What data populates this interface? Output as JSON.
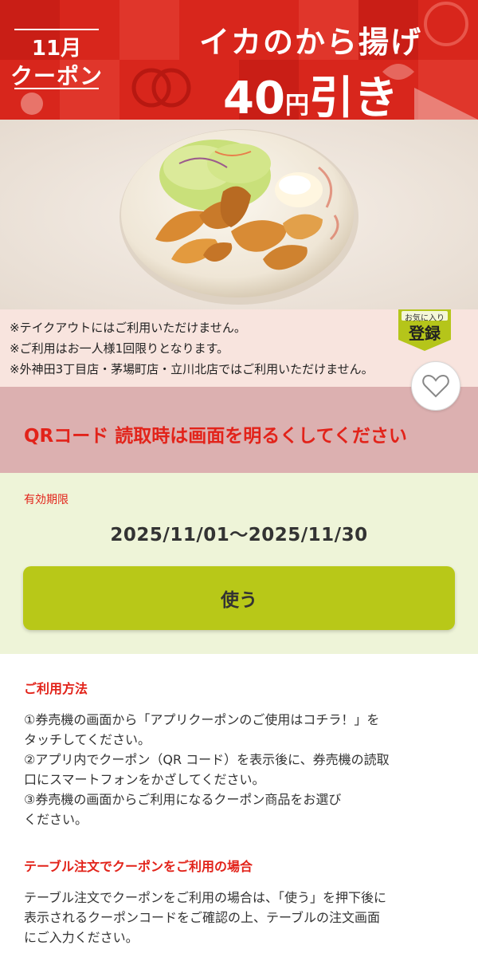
{
  "banner": {
    "month": "11月",
    "coupon": "クーポン",
    "title": "イカのから揚げ",
    "price_number": "40",
    "price_yen": "円",
    "price_off": "引き"
  },
  "notes": [
    "※テイクアウトにはご利用いただけません。",
    "※ご利用はお一人様1回限りとなります。",
    "※外神田3丁目店・茅場町店・立川北店ではご利用いただけません。"
  ],
  "favorite_tag": {
    "small": "お気に入り",
    "big": "登録"
  },
  "qr_notice": "QRコード 読取時は画面を明るくしてください",
  "validity": {
    "label": "有効期限",
    "dates": "2025/11/01～2025/11/30"
  },
  "use_button": "使う",
  "howto": {
    "heading": "ご利用方法",
    "steps": [
      "①券売機の画面から「アプリクーポンのご使用はコチラ！」を",
      "タッチしてください。",
      "②アプリ内でクーポン（QR コード）を表示後に、券売機の読取",
      "口にスマートフォンをかざしてください。",
      "③券売機の画面からご利用になるクーポン商品をお選び",
      "ください。"
    ]
  },
  "table_order": {
    "heading": "テーブル注文でクーポンをご利用の場合",
    "lines": [
      "テーブル注文でクーポンをご利用の場合は、「使う」を押下後に",
      "表示されるクーポンコードをご確認の上、テーブルの注文画面",
      "にご入力ください。"
    ]
  },
  "colors": {
    "banner_red": "#d8261c",
    "accent_red": "#e2231a",
    "use_button": "#b8c818",
    "validity_bg": "#eef4d8",
    "qr_band_bg": "#dcb0b0",
    "notes_bg": "#f8e4de"
  }
}
